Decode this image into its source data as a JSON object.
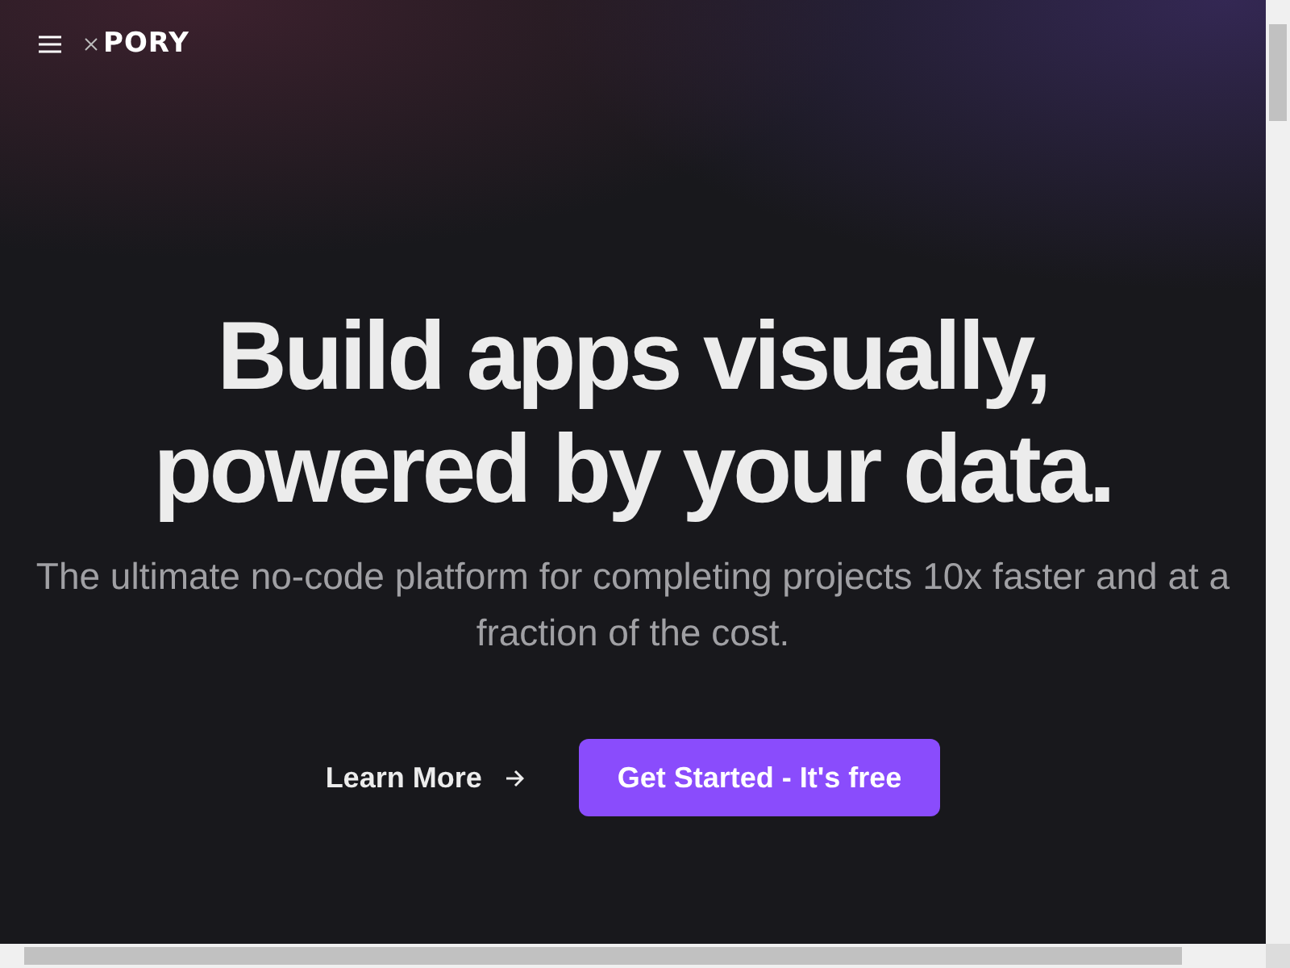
{
  "header": {
    "logo_text": "PORY"
  },
  "hero": {
    "title_lines": [
      "Build apps visually,",
      "powered by your data."
    ],
    "subtitle": "The ultimate no-code platform for completing projects 10x faster and at a fraction of the cost.",
    "secondary_button": "Learn More",
    "primary_button": "Get Started - It's free"
  }
}
